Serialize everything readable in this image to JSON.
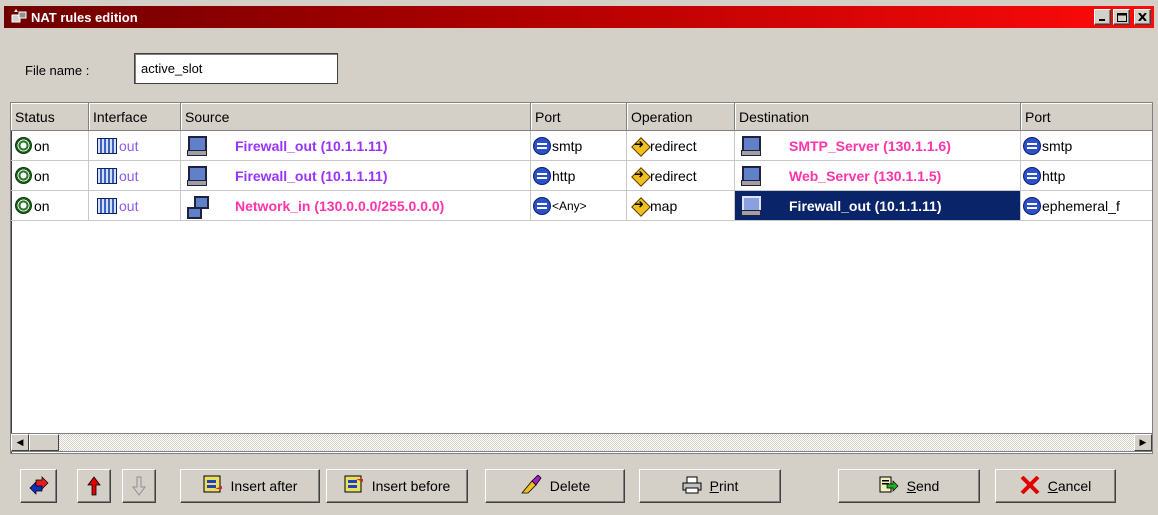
{
  "window": {
    "title": "NAT rules edition"
  },
  "file": {
    "label": "File name :",
    "value": "active_slot"
  },
  "columns": [
    "Status",
    "Interface",
    "Source",
    "Port",
    "Operation",
    "Destination",
    "Port"
  ],
  "rows": [
    {
      "status": "on",
      "interface": "out",
      "source": "Firewall_out (10.1.1.11)",
      "source_color": "#9933ff",
      "source_icon": "host-icon",
      "port": "smtp",
      "operation": "redirect",
      "destination": "SMTP_Server (130.1.1.6)",
      "destination_color": "#ff33aa",
      "dport": "smtp",
      "selected": false
    },
    {
      "status": "on",
      "interface": "out",
      "source": "Firewall_out (10.1.1.11)",
      "source_color": "#9933ff",
      "source_icon": "host-icon",
      "port": "http",
      "operation": "redirect",
      "destination": "Web_Server (130.1.1.5)",
      "destination_color": "#ff33aa",
      "dport": "http",
      "selected": false
    },
    {
      "status": "on",
      "interface": "out",
      "source": "Network_in (130.0.0.0/255.0.0.0)",
      "source_color": "#ff33aa",
      "source_icon": "network-icon",
      "port": "<Any>",
      "operation": "map",
      "destination": "Firewall_out (10.1.1.11)",
      "destination_color": "#ffffff",
      "dport": "ephemeral_f",
      "selected": true
    }
  ],
  "buttons": {
    "insert_after": "Insert after",
    "insert_before": "Insert before",
    "delete": "Delete",
    "print_p": "P",
    "print_rest": "rint",
    "send_s": "S",
    "send_rest": "end",
    "cancel_c": "C",
    "cancel_rest": "ancel"
  },
  "colors": {
    "title_bar_start": "#6e0000",
    "title_bar_end": "#ff0a0a",
    "selection": "#0a246a"
  }
}
